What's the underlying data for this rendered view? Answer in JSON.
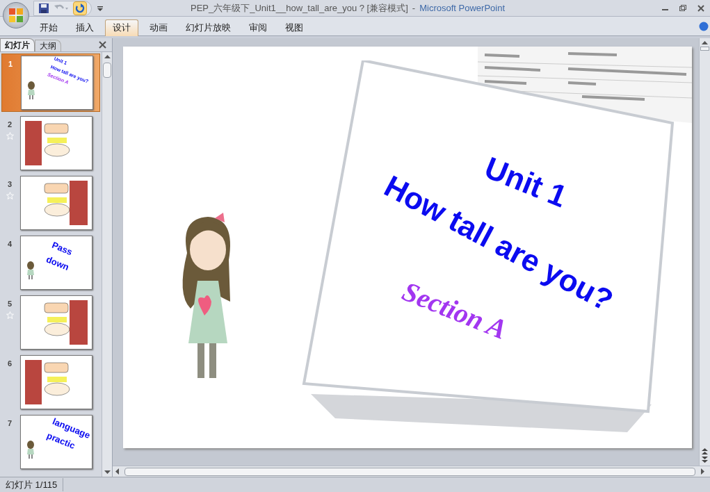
{
  "window": {
    "document": "PEP_六年级下_Unit1__how_tall_are_you ? [兼容模式]",
    "separator": "-",
    "app": "Microsoft PowerPoint"
  },
  "ribbon_tabs": [
    {
      "label": "开始",
      "selected": false
    },
    {
      "label": "插入",
      "selected": false
    },
    {
      "label": "设计",
      "selected": true
    },
    {
      "label": "动画",
      "selected": false
    },
    {
      "label": "幻灯片放映",
      "selected": false
    },
    {
      "label": "审阅",
      "selected": false
    },
    {
      "label": "视图",
      "selected": false
    }
  ],
  "panel_tabs": [
    {
      "label": "幻灯片",
      "selected": true
    },
    {
      "label": "大纲",
      "selected": false
    }
  ],
  "slides": [
    {
      "number": "1",
      "selected": true,
      "animated": false,
      "kind": "title",
      "texts": [
        "Unit 1",
        "How tall are you?",
        "Section A"
      ]
    },
    {
      "number": "2",
      "selected": false,
      "animated": true,
      "kind": "picture"
    },
    {
      "number": "3",
      "selected": false,
      "animated": true,
      "kind": "picture"
    },
    {
      "number": "4",
      "selected": false,
      "animated": false,
      "kind": "title",
      "texts": [
        "Pass",
        "down"
      ]
    },
    {
      "number": "5",
      "selected": false,
      "animated": true,
      "kind": "picture"
    },
    {
      "number": "6",
      "selected": false,
      "animated": false,
      "kind": "picture"
    },
    {
      "number": "7",
      "selected": false,
      "animated": false,
      "kind": "title",
      "texts": [
        "language",
        "practic"
      ]
    }
  ],
  "slide": {
    "unit": "Unit 1",
    "title": "How tall are you?",
    "section": "Section A"
  },
  "status_bar": {
    "slide_counter": "幻灯片 1/115"
  }
}
